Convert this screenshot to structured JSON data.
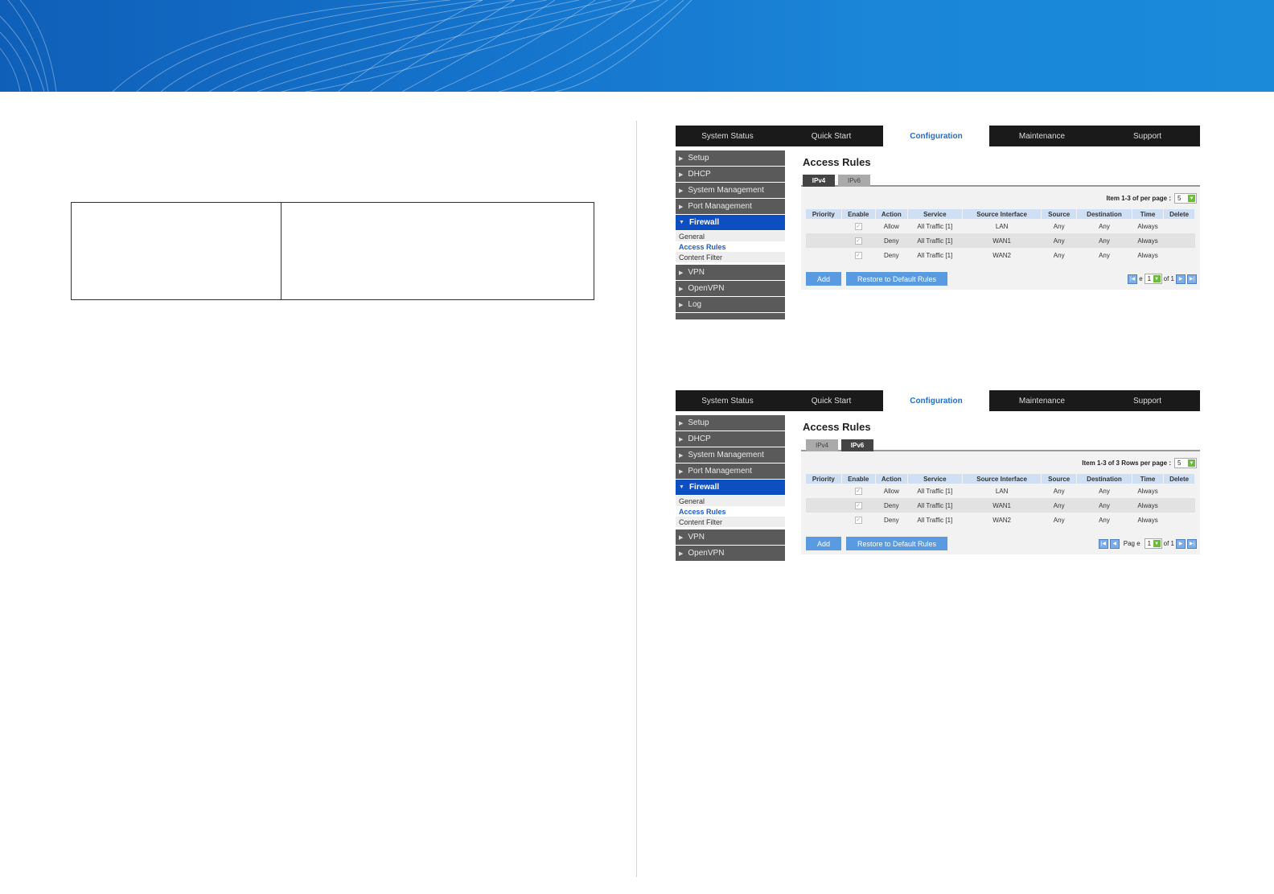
{
  "nav": {
    "items": [
      "System Status",
      "Quick Start",
      "Configuration",
      "Maintenance",
      "Support"
    ]
  },
  "sidebar": {
    "items_top": [
      "Setup",
      "DHCP",
      "System Management",
      "Port Management"
    ],
    "active": "Firewall",
    "sub": [
      "General",
      "Access Rules",
      "Content Filter"
    ],
    "items_bottom": [
      "VPN",
      "OpenVPN",
      "Log"
    ]
  },
  "sidebar2": {
    "items_bottom": [
      "VPN",
      "OpenVPN"
    ]
  },
  "content": {
    "title": "Access Rules",
    "tabs": [
      "IPv4",
      "IPv6"
    ],
    "per_page_label_1": "Item 1-3 of  per page :",
    "per_page_label_2": "Item 1-3 of 3 Rows per page :",
    "per_page_value": "5",
    "columns": [
      "Priority",
      "Enable",
      "Action",
      "Service",
      "Source Interface",
      "Source",
      "Destination",
      "Time",
      "Delete"
    ],
    "rows": [
      {
        "enable": "✓",
        "action": "Allow",
        "service": "All Traffic [1]",
        "iface": "LAN",
        "source": "Any",
        "dest": "Any",
        "time": "Always"
      },
      {
        "enable": "✓",
        "action": "Deny",
        "service": "All Traffic [1]",
        "iface": "WAN1",
        "source": "Any",
        "dest": "Any",
        "time": "Always"
      },
      {
        "enable": "✓",
        "action": "Deny",
        "service": "All Traffic [1]",
        "iface": "WAN2",
        "source": "Any",
        "dest": "Any",
        "time": "Always"
      }
    ],
    "add": "Add",
    "restore": "Restore to Default Rules",
    "page_label_1": "e",
    "page_label_2": "Pag e",
    "page_value": "1",
    "page_of": "of 1"
  },
  "colors": {
    "banner": "#1574cc",
    "active_nav": "#1e6fd0",
    "sidebar_active": "#0d4fc0"
  }
}
